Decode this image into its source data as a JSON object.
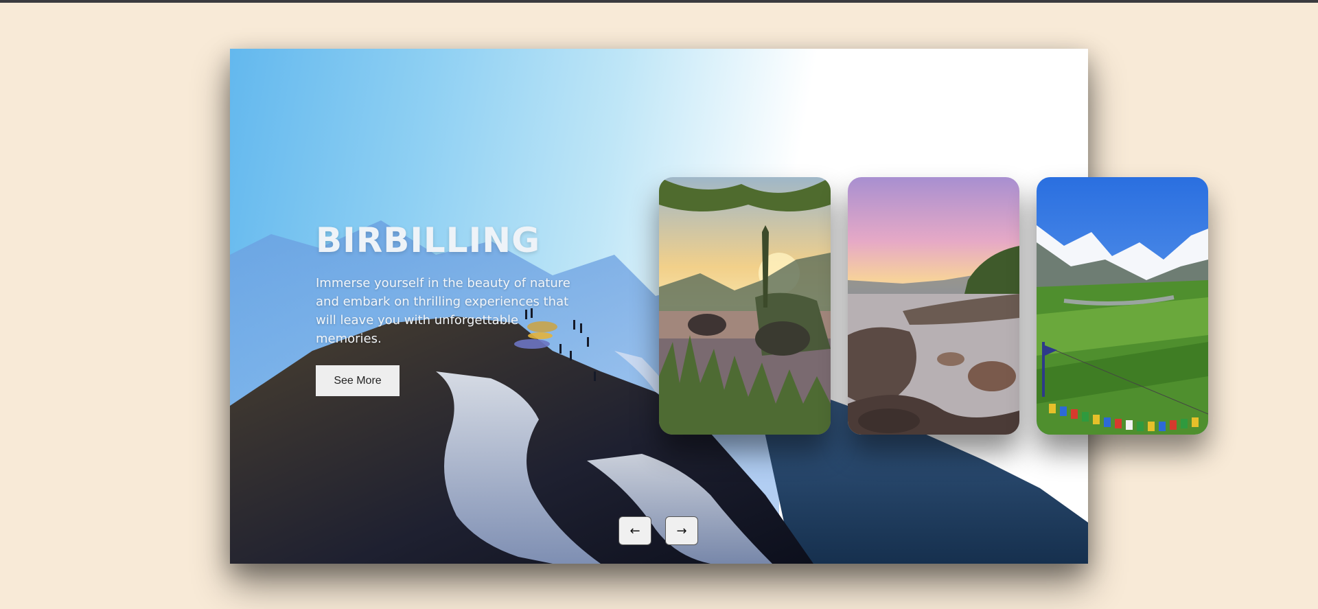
{
  "hero": {
    "title": "BIRBILLING",
    "description": "Immerse yourself in the beauty of nature and embark on thrilling experiences that will leave you with unforgettable memories.",
    "button_label": "See More"
  },
  "cards": [
    {
      "scene": "lake-sunset-with-rocks-and-trees"
    },
    {
      "scene": "rocky-shore-with-driftwood-at-dusk"
    },
    {
      "scene": "green-valley-with-snow-peaks-and-prayer-flags"
    }
  ],
  "navigation": {
    "prev_icon": "arrow-left-icon",
    "prev_glyph": "←",
    "next_icon": "arrow-right-icon",
    "next_glyph": "→"
  },
  "colors": {
    "page_background": "#f8ead7",
    "sky": "#63b8ee",
    "button_background": "#eeeeee"
  }
}
